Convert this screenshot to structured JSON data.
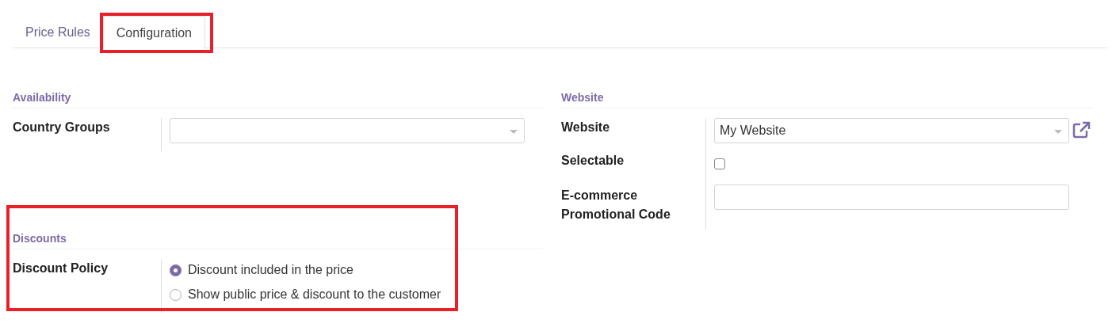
{
  "tabs": [
    {
      "label": "Price Rules",
      "selected": false,
      "highlighted": false
    },
    {
      "label": "Configuration",
      "selected": true,
      "highlighted": true
    }
  ],
  "availability": {
    "title": "Availability",
    "fields": [
      {
        "label": "Country Groups",
        "kind": "select"
      }
    ]
  },
  "website": {
    "title": "Website",
    "fields": [
      {
        "label": "Website",
        "kind": "select",
        "value": "My Website",
        "link": true
      },
      {
        "label": "Selectable",
        "kind": "checkbox",
        "checked": false
      },
      {
        "label": "E-commerce Promotional Code",
        "kind": "text"
      }
    ]
  },
  "discounts": {
    "title": "Discounts",
    "highlighted": true,
    "fields": [
      {
        "label": "Discount Policy",
        "kind": "radio",
        "options": [
          {
            "label": "Discount included in the price",
            "selected": true
          },
          {
            "label": "Show public price & discount to the customer",
            "selected": false
          }
        ]
      }
    ]
  }
}
